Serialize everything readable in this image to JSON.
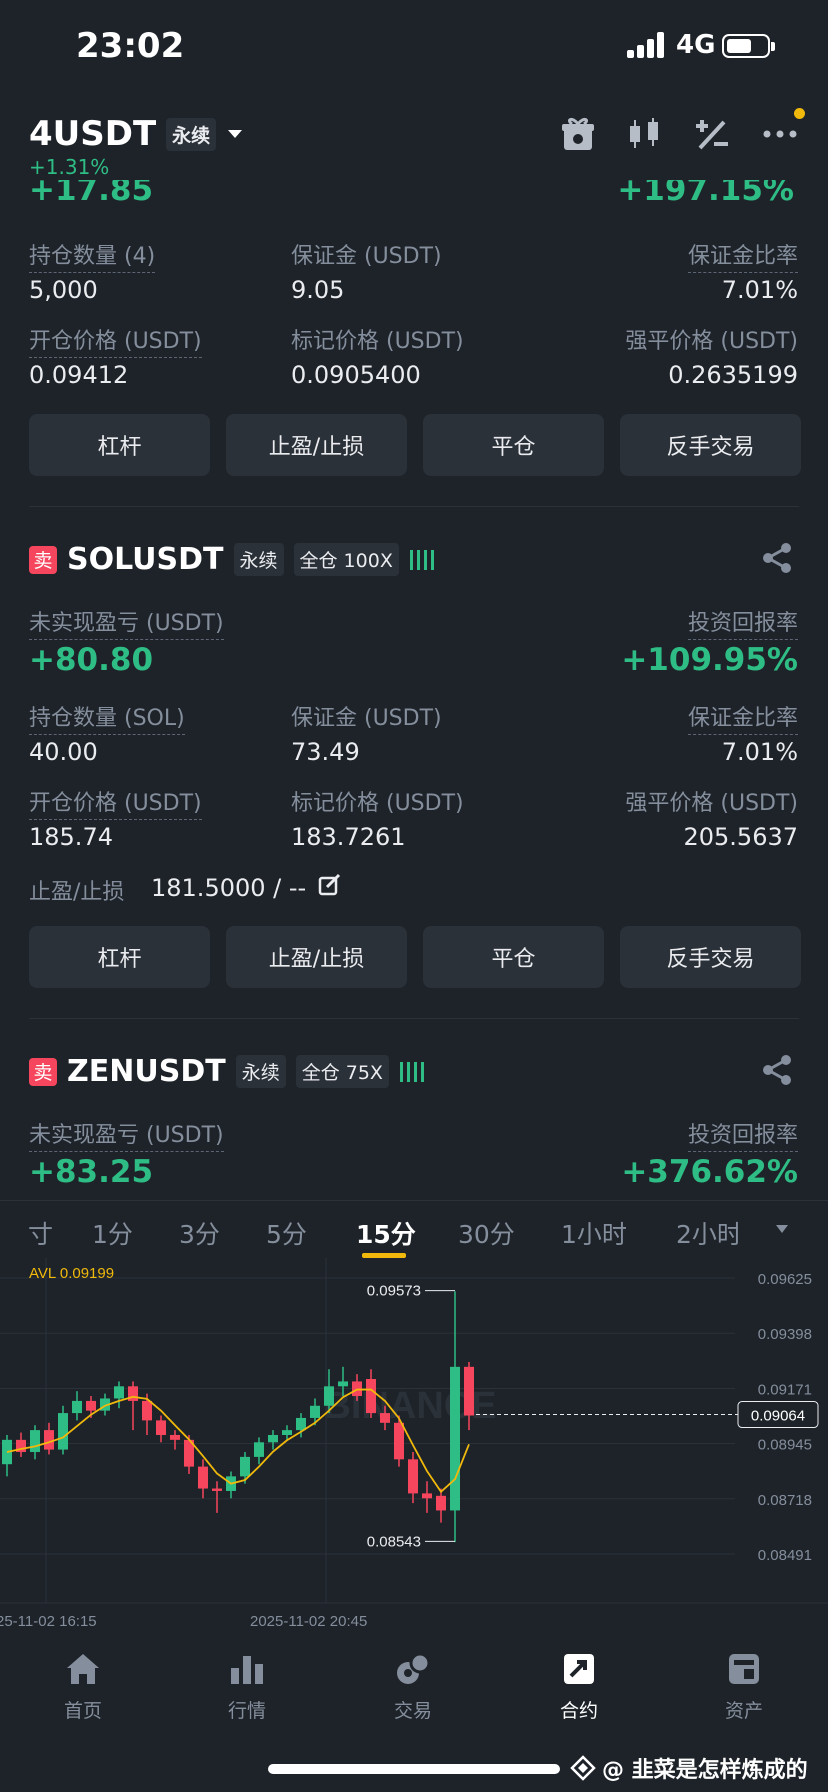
{
  "status": {
    "time": "23:02",
    "network": "4G"
  },
  "header": {
    "symbol": "4USDT",
    "perp_tag": "永续",
    "change": "+1.31%"
  },
  "pos1": {
    "pnl_partial": "+17.85",
    "roe_partial": "+197.15%",
    "qty_label": "持仓数量 (4)",
    "qty": "5,000",
    "margin_label": "保证金 (USDT)",
    "margin": "9.05",
    "ratio_label": "保证金比率",
    "ratio": "7.01%",
    "entry_label": "开仓价格 (USDT)",
    "entry": "0.09412",
    "mark_label": "标记价格 (USDT)",
    "mark": "0.0905400",
    "liq_label": "强平价格 (USDT)",
    "liq": "0.2635199"
  },
  "buttons": {
    "leverage": "杠杆",
    "tpsl": "止盈/止损",
    "close": "平仓",
    "reverse": "反手交易"
  },
  "pos2": {
    "side": "卖",
    "symbol": "SOLUSDT",
    "perp_tag": "永续",
    "mode_tag": "全仓 100X",
    "pnl_label": "未实现盈亏 (USDT)",
    "pnl": "+80.80",
    "roe_label": "投资回报率",
    "roe": "+109.95%",
    "qty_label": "持仓数量 (SOL)",
    "qty": "40.00",
    "margin_label": "保证金 (USDT)",
    "margin": "73.49",
    "ratio_label": "保证金比率",
    "ratio": "7.01%",
    "entry_label": "开仓价格 (USDT)",
    "entry": "185.74",
    "mark_label": "标记价格 (USDT)",
    "mark": "183.7261",
    "liq_label": "强平价格 (USDT)",
    "liq": "205.5637",
    "tpsl_label": "止盈/止损",
    "tpsl_value": "181.5000 / --"
  },
  "pos3": {
    "side": "卖",
    "symbol": "ZENUSDT",
    "perp_tag": "永续",
    "mode_tag": "全仓 75X",
    "pnl_label": "未实现盈亏 (USDT)",
    "pnl": "+83.25",
    "roe_label": "投资回报率",
    "roe": "+376.62%"
  },
  "timeframes": [
    "寸",
    "1分",
    "3分",
    "5分",
    "15分",
    "30分",
    "1小时",
    "2小时"
  ],
  "chart_data": {
    "type": "candlestick",
    "indicator_label": "AVL 0.09199",
    "y_ticks": [
      0.09625,
      0.09398,
      0.09171,
      0.08945,
      0.08718,
      0.08491
    ],
    "ylim": [
      0.08491,
      0.09625
    ],
    "x_ticks": [
      "25-11-02 16:15",
      "2025-11-02 20:45"
    ],
    "high_label": "0.09573",
    "low_label": "0.08543",
    "current_price": "0.09064",
    "watermark": "BINANCE",
    "candles": [
      [
        0.0886,
        0.0896,
        0.0881,
        0.0898
      ],
      [
        0.0896,
        0.0891,
        0.0889,
        0.0899
      ],
      [
        0.0891,
        0.09,
        0.0888,
        0.0902
      ],
      [
        0.09,
        0.0892,
        0.089,
        0.0903
      ],
      [
        0.0892,
        0.0907,
        0.089,
        0.091
      ],
      [
        0.0907,
        0.0912,
        0.0904,
        0.0916
      ],
      [
        0.0912,
        0.0908,
        0.0905,
        0.0914
      ],
      [
        0.0908,
        0.0913,
        0.0906,
        0.0915
      ],
      [
        0.0913,
        0.0918,
        0.0909,
        0.092
      ],
      [
        0.0918,
        0.0912,
        0.09,
        0.092
      ],
      [
        0.0912,
        0.0904,
        0.0898,
        0.0915
      ],
      [
        0.0904,
        0.0898,
        0.0895,
        0.0906
      ],
      [
        0.0898,
        0.0896,
        0.0892,
        0.09
      ],
      [
        0.0896,
        0.0885,
        0.0882,
        0.0898
      ],
      [
        0.0885,
        0.0876,
        0.0872,
        0.0888
      ],
      [
        0.0876,
        0.0875,
        0.0866,
        0.0879
      ],
      [
        0.0875,
        0.0881,
        0.0872,
        0.0883
      ],
      [
        0.0881,
        0.0889,
        0.0878,
        0.0891
      ],
      [
        0.0889,
        0.0895,
        0.0886,
        0.0897
      ],
      [
        0.0895,
        0.0898,
        0.0892,
        0.09
      ],
      [
        0.0898,
        0.09,
        0.0896,
        0.0902
      ],
      [
        0.09,
        0.0905,
        0.0897,
        0.0907
      ],
      [
        0.0905,
        0.091,
        0.0902,
        0.0913
      ],
      [
        0.091,
        0.0918,
        0.0907,
        0.0925
      ],
      [
        0.0918,
        0.092,
        0.0914,
        0.0926
      ],
      [
        0.092,
        0.0914,
        0.0912,
        0.0923
      ],
      [
        0.0921,
        0.0907,
        0.0905,
        0.0925
      ],
      [
        0.0907,
        0.0903,
        0.09,
        0.091
      ],
      [
        0.0903,
        0.0888,
        0.0885,
        0.0906
      ],
      [
        0.0888,
        0.0874,
        0.087,
        0.0891
      ],
      [
        0.0874,
        0.0872,
        0.0866,
        0.0879
      ],
      [
        0.0873,
        0.0867,
        0.0862,
        0.0876
      ],
      [
        0.0867,
        0.0926,
        0.0854,
        0.0957
      ],
      [
        0.0926,
        0.0906,
        0.09,
        0.0928
      ]
    ]
  },
  "nav": [
    "首页",
    "行情",
    "交易",
    "合约",
    "资产"
  ],
  "watermark_text": "@ 韭菜是怎样炼成的"
}
